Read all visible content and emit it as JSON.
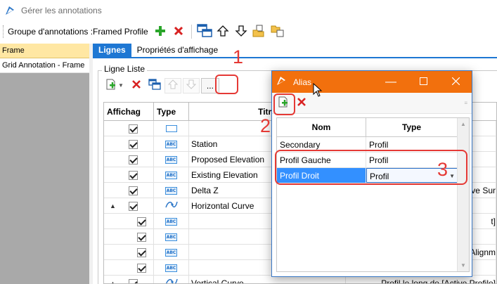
{
  "window": {
    "title": "Gérer les annotations"
  },
  "toolbar": {
    "group_label": "Groupe d'annotations :Framed Profile"
  },
  "left_panel": {
    "items": [
      {
        "label": "Frame",
        "selected": true
      },
      {
        "label": "Grid Annotation - Frame",
        "selected": false
      }
    ]
  },
  "tabs": [
    {
      "label": "Lignes",
      "active": true
    },
    {
      "label": "Propriétés d'affichage",
      "active": false
    }
  ],
  "ligne_liste": {
    "group_title": "Ligne Liste",
    "ellipsis_label": "...",
    "columns": [
      "Affichag",
      "Type",
      "Titre"
    ],
    "rows": [
      {
        "indent": 0,
        "expander": "",
        "checked": true,
        "icon": "rectangle-icon",
        "title": "",
        "rest": ""
      },
      {
        "indent": 0,
        "expander": "",
        "checked": true,
        "icon": "text-abc-icon",
        "title": "Station",
        "rest": ""
      },
      {
        "indent": 0,
        "expander": "",
        "checked": true,
        "icon": "text-abc-icon",
        "title": "Proposed Elevation",
        "rest": ""
      },
      {
        "indent": 0,
        "expander": "",
        "checked": true,
        "icon": "text-abc-icon",
        "title": "Existing Elevation",
        "rest": ""
      },
      {
        "indent": 0,
        "expander": "",
        "checked": true,
        "icon": "text-abc-icon",
        "title": "Delta Z",
        "rest": "ive Sur"
      },
      {
        "indent": 0,
        "expander": "▲",
        "checked": true,
        "icon": "curve-icon",
        "title": "Horizontal Curve",
        "rest": ""
      },
      {
        "indent": 1,
        "expander": "",
        "checked": true,
        "icon": "text-abc-icon",
        "title": "",
        "rest": "t]"
      },
      {
        "indent": 1,
        "expander": "",
        "checked": true,
        "icon": "text-abc-icon",
        "title": "",
        "rest": ""
      },
      {
        "indent": 1,
        "expander": "",
        "checked": true,
        "icon": "text-abc-icon",
        "title": "",
        "rest": "Alignm"
      },
      {
        "indent": 1,
        "expander": "",
        "checked": true,
        "icon": "text-abc-icon",
        "title": "",
        "rest": ""
      },
      {
        "indent": 0,
        "expander": "▲",
        "checked": true,
        "icon": "curve-icon",
        "title": "Vertical Curve",
        "rest": "Profil le long de [Active Profile]"
      }
    ]
  },
  "alias_dialog": {
    "title": "Alias",
    "columns": [
      "Nom",
      "Type"
    ],
    "rows": [
      {
        "nom": "Secondary",
        "type": "Profil",
        "selected": false,
        "combo": false
      },
      {
        "nom": "Profil Gauche",
        "type": "Profil",
        "selected": false,
        "combo": false
      },
      {
        "nom": "Profil Droit",
        "type": "Profil",
        "selected": true,
        "combo": true
      }
    ]
  },
  "annotations": {
    "one": "1",
    "two": "2",
    "three": "3"
  },
  "colors": {
    "accent": "#1e77d3",
    "dialog_title": "#f2700d",
    "annotation_red": "#e53935",
    "selection": "#3390ff",
    "left_selected": "#ffe7a3"
  }
}
